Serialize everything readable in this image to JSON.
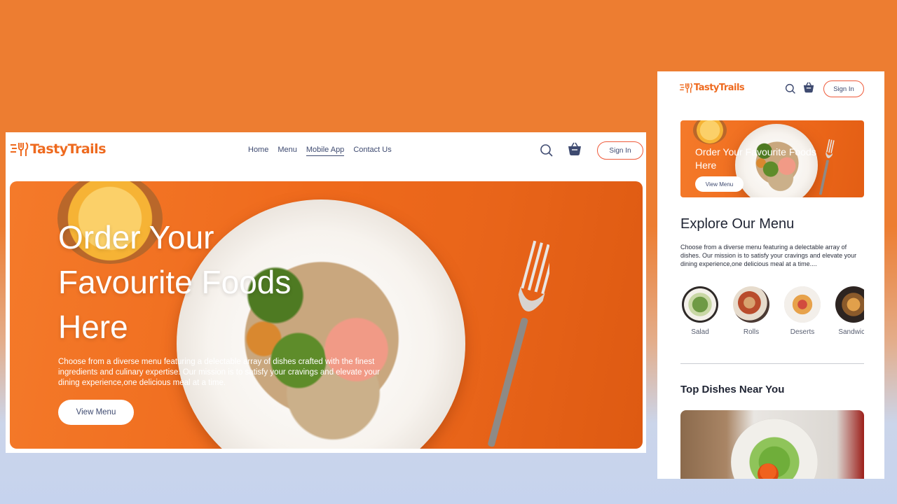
{
  "brand": {
    "name": "TastyTrails",
    "accent": "#EE6A1F",
    "nav_color": "#3E4A70"
  },
  "desktop": {
    "nav": {
      "home": "Home",
      "menu": "Menu",
      "mobile_app": "Mobile App",
      "contact": "Contact Us",
      "active": "Mobile App"
    },
    "icons": {
      "search": "search-icon",
      "cart": "basket-icon"
    },
    "sign_in": "Sign In",
    "hero": {
      "title": "Order Your Favourite Foods Here",
      "description": "Choose from a diverse menu featuring a delectable array of dishes crafted with the finest ingredients and culinary expertise. Our mission is to satisfy your cravings and elevate your dining experience,one delicious meal at a time.",
      "cta": "View Menu"
    }
  },
  "mobile": {
    "sign_in": "Sign In",
    "hero": {
      "title": "Order Your Favourite Foods Here",
      "cta": "View Menu"
    },
    "explore": {
      "title": "Explore Our Menu",
      "description": "Choose from a diverse menu featuring a delectable array of dishes. Our mission is to satisfy your cravings and elevate your dining experience,one delicious meal at a time....",
      "categories": [
        {
          "label": "Salad"
        },
        {
          "label": "Rolls"
        },
        {
          "label": "Deserts"
        },
        {
          "label": "Sandwich"
        }
      ]
    },
    "top_dishes": {
      "title": "Top Dishes Near You"
    }
  }
}
